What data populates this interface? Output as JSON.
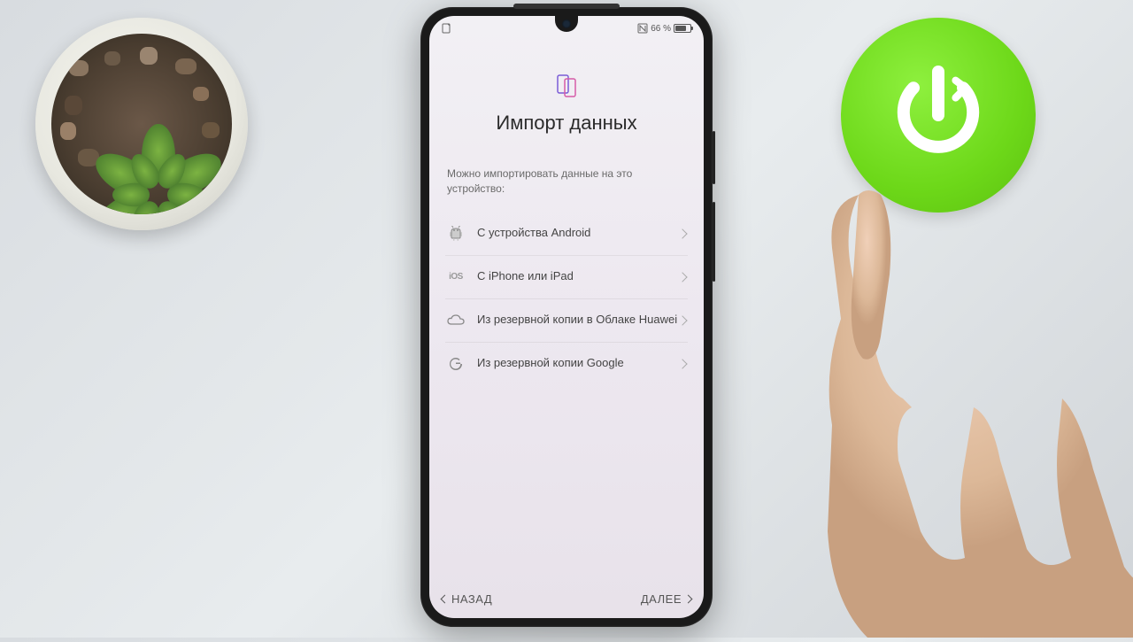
{
  "status": {
    "battery_pct": "66 %"
  },
  "screen": {
    "title": "Импорт данных",
    "subtitle": "Можно импортировать данные на это устройство:",
    "options": [
      {
        "label": "С устройства Android"
      },
      {
        "label": "С iPhone или iPad"
      },
      {
        "label": "Из резервной копии в Облаке Huawei"
      },
      {
        "label": "Из резервной копии Google"
      }
    ]
  },
  "footer": {
    "back": "НАЗАД",
    "next": "ДАЛЕЕ"
  },
  "icons": {
    "ios_text": "iOS"
  }
}
